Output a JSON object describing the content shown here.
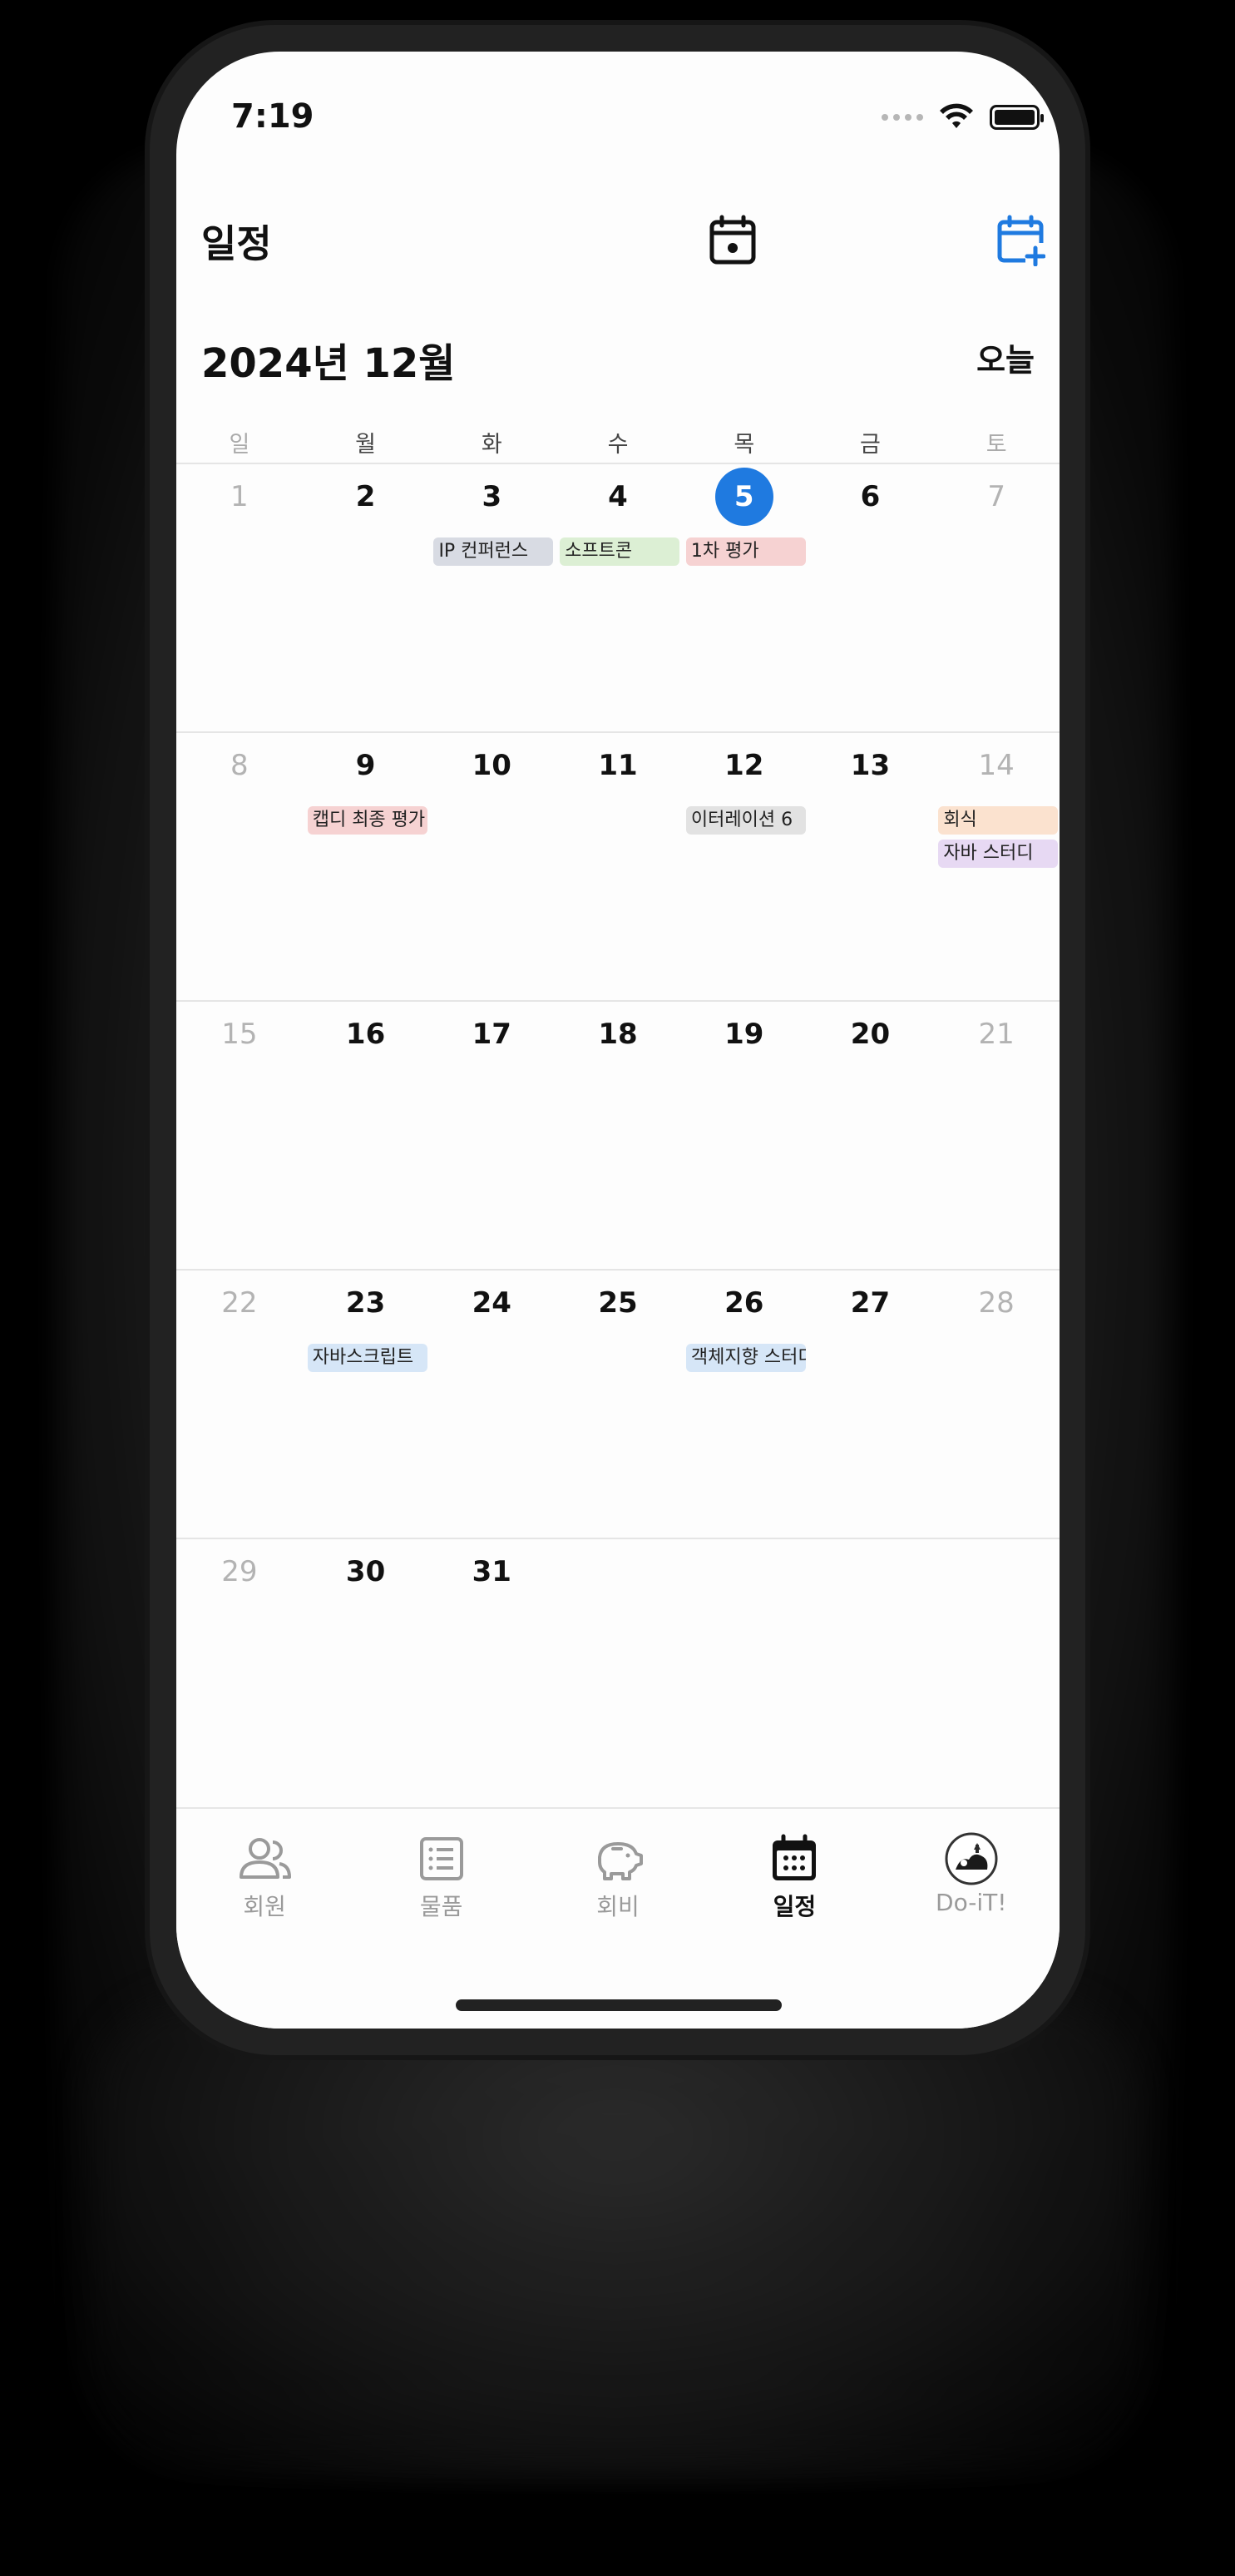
{
  "status_bar": {
    "time": "7:19"
  },
  "header": {
    "title": "일정",
    "month_label": "2024년 12월",
    "today_button": "오늘",
    "accent_color": "#1f7ae0"
  },
  "calendar": {
    "weekdays": [
      "일",
      "월",
      "화",
      "수",
      "목",
      "금",
      "토"
    ],
    "weeks": [
      {
        "days": [
          "1",
          "2",
          "3",
          "4",
          "5",
          "6",
          "7"
        ]
      },
      {
        "days": [
          "8",
          "9",
          "10",
          "11",
          "12",
          "13",
          "14"
        ]
      },
      {
        "days": [
          "15",
          "16",
          "17",
          "18",
          "19",
          "20",
          "21"
        ]
      },
      {
        "days": [
          "22",
          "23",
          "24",
          "25",
          "26",
          "27",
          "28"
        ]
      },
      {
        "days": [
          "29",
          "30",
          "31",
          "",
          "",
          "",
          ""
        ]
      }
    ],
    "today": "5",
    "events": {
      "d3": "IP 컨퍼런스",
      "d4": "소프트콘",
      "d5": "1차 평가",
      "d9": "캡디 최종 평가",
      "d12": "이터레이션 6",
      "d14a": "회식",
      "d14b": "자바 스터디",
      "d23": "자바스크립트",
      "d26": "객체지향 스터디"
    }
  },
  "tabbar": {
    "tabs": [
      {
        "label": "회원",
        "icon": "members-icon"
      },
      {
        "label": "물품",
        "icon": "list-icon"
      },
      {
        "label": "회비",
        "icon": "piggy-bank-icon"
      },
      {
        "label": "일정",
        "icon": "calendar-icon"
      },
      {
        "label": "Do-iT!",
        "icon": "doit-logo-icon"
      }
    ],
    "active": "일정"
  }
}
